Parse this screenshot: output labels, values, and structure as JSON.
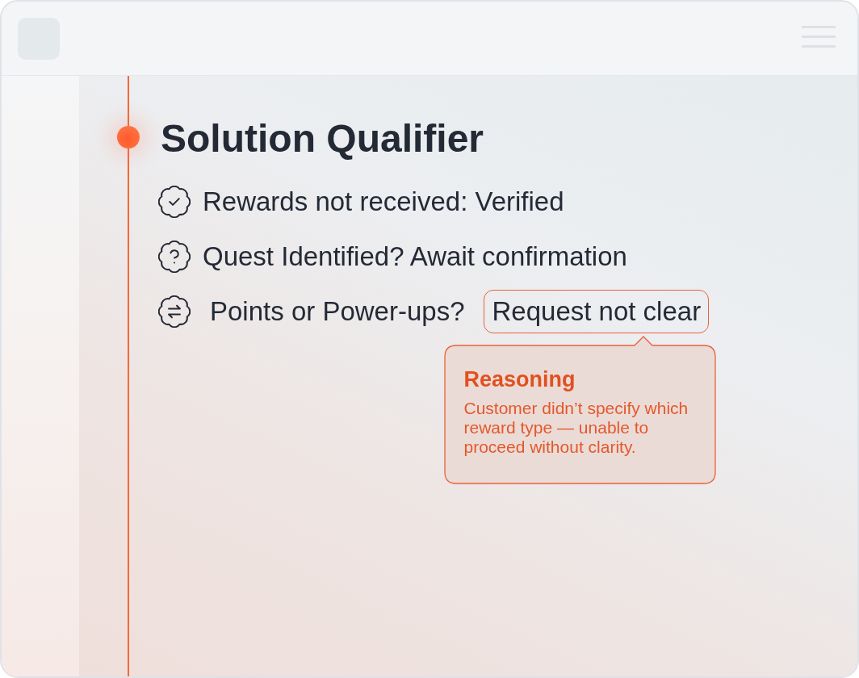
{
  "title": "Solution Qualifier",
  "checks": [
    {
      "kind": "verified",
      "text": "Rewards not received: Verified"
    },
    {
      "kind": "question",
      "text": "Quest Identified? Await confirmation"
    },
    {
      "kind": "exchange",
      "text": "Points or Power-ups?",
      "flag": {
        "label": "Request not clear",
        "tooltip": {
          "title": "Reasoning",
          "body": "Customer didn’t specify which reward type — unable to proceed without clarity."
        }
      }
    }
  ]
}
